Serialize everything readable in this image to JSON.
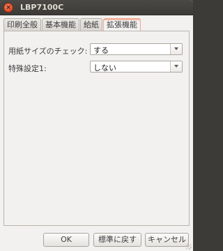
{
  "window": {
    "title": "LBP7100C"
  },
  "tabs": [
    {
      "label": "印刷全般",
      "active": false
    },
    {
      "label": "基本機能",
      "active": false
    },
    {
      "label": "給紙",
      "active": false
    },
    {
      "label": "拡張機能",
      "active": true
    }
  ],
  "settings": [
    {
      "label": "用紙サイズのチェック:",
      "value": "する"
    },
    {
      "label": "特殊設定1:",
      "value": "しない"
    }
  ],
  "buttons": {
    "ok": "OK",
    "reset": "標準に戻す",
    "cancel": "キャンセル"
  },
  "colors": {
    "accent": "#f0a891",
    "titlebar": "#3c3b37",
    "close": "#e0522c"
  }
}
